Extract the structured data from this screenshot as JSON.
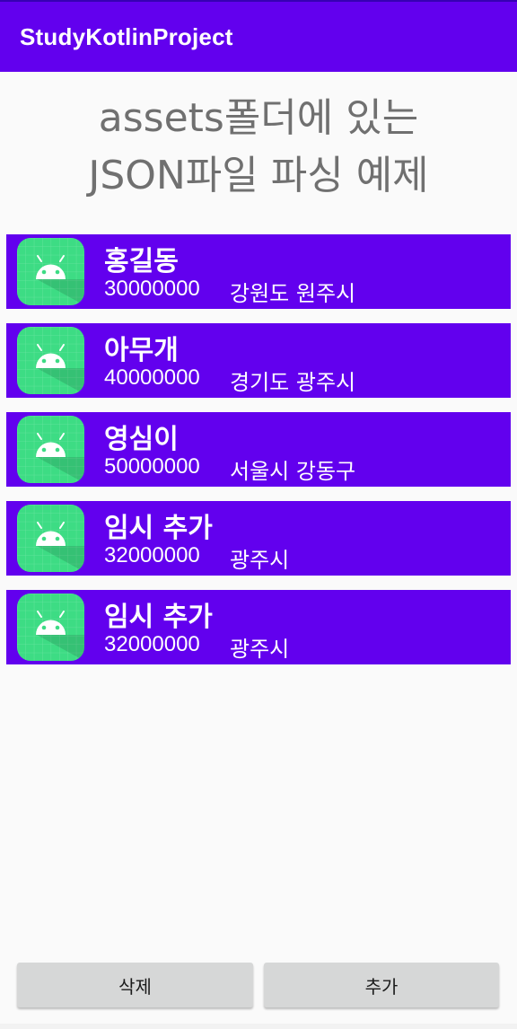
{
  "app_bar": {
    "title": "StudyKotlinProject",
    "color": "#6200ee"
  },
  "heading": {
    "line1": "assets폴더에 있는",
    "line2": "JSON파일 파싱 예제"
  },
  "list": {
    "item_color": "#6200ee",
    "icon": "android-launcher-icon",
    "items": [
      {
        "name": "홍길동",
        "salary": "30000000",
        "address": "강원도 원주시"
      },
      {
        "name": "아무개",
        "salary": "40000000",
        "address": "경기도 광주시"
      },
      {
        "name": "영심이",
        "salary": "50000000",
        "address": "서울시 강동구"
      },
      {
        "name": "임시 추가",
        "salary": "32000000",
        "address": "광주시"
      },
      {
        "name": "임시 추가",
        "salary": "32000000",
        "address": "광주시"
      }
    ]
  },
  "buttons": {
    "delete_label": "삭제",
    "add_label": "추가"
  }
}
